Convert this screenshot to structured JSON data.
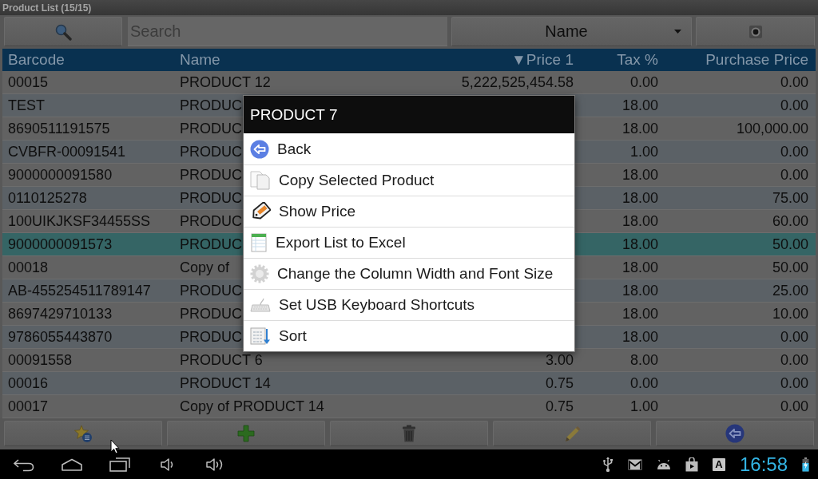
{
  "window": {
    "title": "Product List (15/15)"
  },
  "toolbar": {
    "search": {
      "placeholder": "Search"
    },
    "sort_by": {
      "value": "Name"
    }
  },
  "table": {
    "columns": [
      "Barcode",
      "Name",
      "▼Price 1",
      "Tax %",
      "Purchase Price"
    ],
    "rows": [
      {
        "barcode": "00015",
        "name": "PRODUCT 12",
        "price_1": "5,222,525,454.58",
        "tax": "0.00",
        "purchase_price": "0.00",
        "selected": false
      },
      {
        "barcode": "TEST",
        "name": "PRODUC",
        "tax": "18.00",
        "purchase_price": "0.00",
        "selected": false
      },
      {
        "barcode": "8690511191575",
        "name": "PRODUC",
        "tax": "18.00",
        "purchase_price": "100,000.00",
        "selected": false
      },
      {
        "barcode": "CVBFR-00091541",
        "name": "PRODUC",
        "tax": "1.00",
        "purchase_price": "0.00",
        "selected": false
      },
      {
        "barcode": "9000000091580",
        "name": "PRODUC",
        "tax": "18.00",
        "purchase_price": "0.00",
        "selected": false
      },
      {
        "barcode": "0110125278",
        "name": "PRODUC",
        "tax": "18.00",
        "purchase_price": "75.00",
        "selected": false
      },
      {
        "barcode": "100UIKJKSF34455SS",
        "name": "PRODUC",
        "tax": "18.00",
        "purchase_price": "60.00",
        "selected": false
      },
      {
        "barcode": "9000000091573",
        "name": "PRODUC",
        "tax": "18.00",
        "purchase_price": "50.00",
        "selected": true
      },
      {
        "barcode": "00018",
        "name": "Copy of",
        "tax": "18.00",
        "purchase_price": "50.00",
        "selected": false
      },
      {
        "barcode": "AB-455254511789147",
        "name": "PRODUC",
        "tax": "18.00",
        "purchase_price": "25.00",
        "selected": false
      },
      {
        "barcode": "8697429710133",
        "name": "PRODUC",
        "tax": "18.00",
        "purchase_price": "10.00",
        "selected": false
      },
      {
        "barcode": "9786055443870",
        "name": "PRODUC",
        "tax": "18.00",
        "purchase_price": "0.00",
        "selected": false
      },
      {
        "barcode": "00091558",
        "name": "PRODUCT 6",
        "price_1": "3.00",
        "tax": "8.00",
        "purchase_price": "0.00",
        "selected": false
      },
      {
        "barcode": "00016",
        "name": "PRODUCT 14",
        "price_1": "0.75",
        "tax": "0.00",
        "purchase_price": "0.00",
        "selected": false
      },
      {
        "barcode": "00017",
        "name": "Copy of PRODUCT 14",
        "price_1": "0.75",
        "tax": "1.00",
        "purchase_price": "0.00",
        "selected": false
      }
    ]
  },
  "context_menu": {
    "title": "PRODUCT 7",
    "items": [
      {
        "label": "Back"
      },
      {
        "label": "Copy Selected Product"
      },
      {
        "label": "Show Price"
      },
      {
        "label": "Export List to Excel"
      },
      {
        "label": "Change the Column Width and Font Size"
      },
      {
        "label": "Set USB Keyboard Shortcuts"
      },
      {
        "label": "Sort"
      }
    ]
  },
  "status_bar": {
    "keyboard_indicator": "A",
    "clock": "16:58"
  }
}
